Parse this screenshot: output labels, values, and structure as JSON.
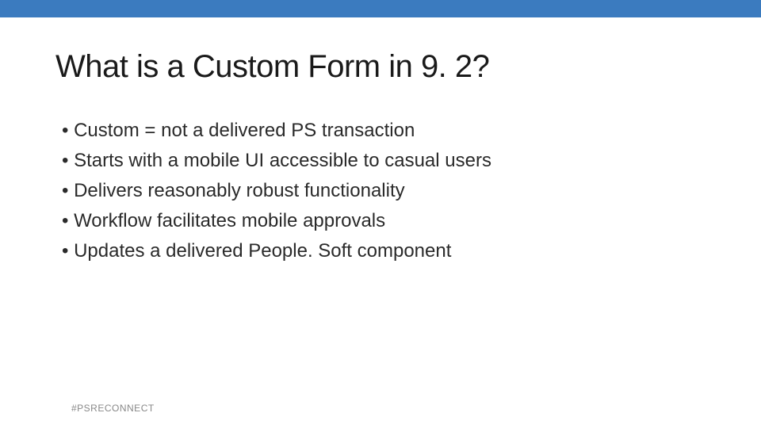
{
  "title": "What is a Custom Form in 9. 2?",
  "bullets": [
    "Custom = not a delivered PS transaction",
    "Starts with a mobile UI accessible to casual users",
    "Delivers reasonably robust functionality",
    "Workflow facilitates mobile approvals",
    "Updates a delivered People. Soft component"
  ],
  "footer": "#PSRECONNECT",
  "colors": {
    "accent": "#3b7bbf"
  }
}
